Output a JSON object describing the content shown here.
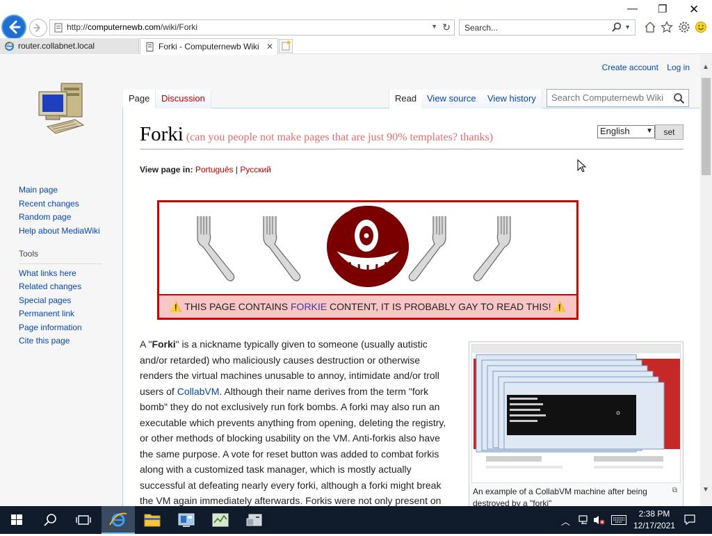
{
  "browser": {
    "url_prefix": "http://",
    "url_domain": "computernewb.com",
    "url_path": "/wiki/Forki",
    "search_placeholder": "Search...",
    "tabs": [
      {
        "title": "router.collabnet.local"
      },
      {
        "title": "Forki - Computernewb Wiki"
      }
    ],
    "tab_close": "✕"
  },
  "wiki": {
    "personal": {
      "create_account": "Create account",
      "login": "Log in"
    },
    "tabs": {
      "page": "Page",
      "discussion": "Discussion",
      "read": "Read",
      "view_source": "View source",
      "view_history": "View history"
    },
    "search_placeholder": "Search Computernewb Wiki",
    "nav": [
      "Main page",
      "Recent changes",
      "Random page",
      "Help about MediaWiki"
    ],
    "tools_heading": "Tools",
    "tools": [
      "What links here",
      "Related changes",
      "Special pages",
      "Permanent link",
      "Page information",
      "Cite this page"
    ],
    "title": "Forki",
    "subtitle": "(can you people not make pages that are just 90% templates? thanks)",
    "language_select": "English",
    "set_button": "set",
    "view_in_label": "View page in:",
    "view_in_langs": [
      "Português",
      "Русский"
    ],
    "view_in_sep": "|",
    "banner": {
      "before": "THIS PAGE CONTAINS ",
      "link": "FORKIE",
      "after": " CONTENT, IT IS PROBABLY GAY TO READ THIS!"
    },
    "paragraph": {
      "p1": "A \"",
      "bold": "Forki",
      "p2": "\" is a nickname typically given to someone (usually autistic and/or retarded) who maliciously causes destruction or otherwise renders the virtual machines unusable to annoy, intimidate and/or troll users of ",
      "link": "CollabVM",
      "p3": ". Although their name derives from the term \"fork bomb\" they do not exclusively run fork bombs. A forki may also run an executable which prevents anything from opening, deleting the registry, or other methods of blocking usability on the VM. Anti-forkis also have the same purpose. A vote for reset button was added to combat forkis along with a customized task manager, which is mostly actually successful at defeating nearly every forki, although a forki might break the VM again immediately afterwards. Forkis were not only present on"
    },
    "thumb_caption": "An example of a CollabVM machine after being destroyed by a \"forki\""
  },
  "taskbar": {
    "time": "2:38 PM",
    "date": "12/17/2021"
  },
  "colors": {
    "link": "#0645ad",
    "redlink": "#ba0000",
    "banner_border": "#cc0000",
    "banner_fill": "#f9c6c6",
    "taskbar": "#0f1b2b"
  }
}
